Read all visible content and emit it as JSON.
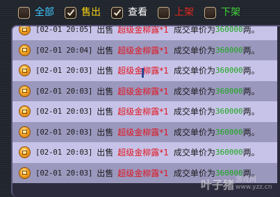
{
  "filters": [
    {
      "id": "all",
      "label": "全部",
      "checked": false,
      "color": "#3fc7ff"
    },
    {
      "id": "sell",
      "label": "售出",
      "checked": true,
      "color": "#f7d417"
    },
    {
      "id": "view",
      "label": "查看",
      "checked": true,
      "color": "#ffffff"
    },
    {
      "id": "list",
      "label": "上架",
      "checked": false,
      "color": "#e2281e"
    },
    {
      "id": "delist",
      "label": "下架",
      "checked": false,
      "color": "#41d43a"
    }
  ],
  "records": [
    {
      "time": "[02-01 20:05]",
      "action": "出售",
      "item": "超级金柳露*1",
      "prefix": "成交单价为",
      "price": "360000",
      "suffix": "两。"
    },
    {
      "time": "[02-01 20:04]",
      "action": "出售",
      "item": "超级金柳露*1",
      "prefix": "成交单价为",
      "price": "360000",
      "suffix": "两。"
    },
    {
      "time": "[02-01 20:03]",
      "action": "出售",
      "item": "超级金柳露*1",
      "prefix": "成交单价为",
      "price": "360000",
      "suffix": "两。"
    },
    {
      "time": "[02-01 20:03]",
      "action": "出售",
      "item": "超级金柳露*1",
      "prefix": "成交单价为",
      "price": "360000",
      "suffix": "两。"
    },
    {
      "time": "[02-01 20:03]",
      "action": "出售",
      "item": "超级金柳露*1",
      "prefix": "成交单价为",
      "price": "360000",
      "suffix": "两。"
    },
    {
      "time": "[02-01 20:03]",
      "action": "出售",
      "item": "超级金柳露*1",
      "prefix": "成交单价为",
      "price": "360000",
      "suffix": "两。"
    },
    {
      "time": "[02-01 20:03]",
      "action": "出售",
      "item": "超级金柳露*1",
      "prefix": "成交单价为",
      "price": "360000",
      "suffix": "两。"
    },
    {
      "time": "[02-01 20:03]",
      "action": "出售",
      "item": "超级金柳露*1",
      "prefix": "成交单价为",
      "price": "360000",
      "suffix": "两。"
    }
  ],
  "colors": {
    "item": "#e1141e",
    "price": "#1aa51a",
    "row_light": "#c7c3e8",
    "row_dark": "#9b98be"
  },
  "watermark": {
    "logo": "叶子猪",
    "cn": "游戏网",
    "url": "www.yzz.cn"
  }
}
